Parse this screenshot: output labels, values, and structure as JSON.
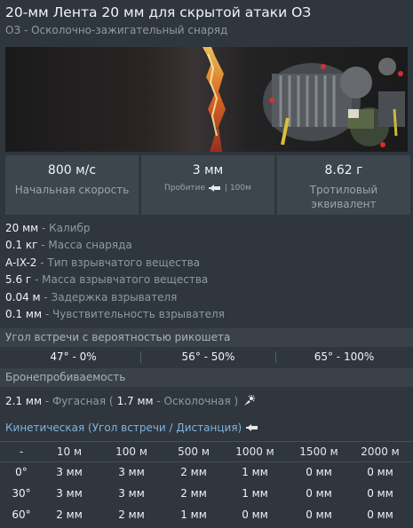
{
  "header": {
    "title": "20-мм Лента 20 мм для скрытой атаки ОЗ",
    "subtitle": "ОЗ - Осколочно-зажигательный снаряд"
  },
  "stats": {
    "velocity": {
      "value": "800 м/с",
      "label": "Начальная скорость"
    },
    "penetration": {
      "value": "3 мм",
      "label": "Пробитие",
      "distance": "| 100м"
    },
    "tnt": {
      "value": "8.62 г",
      "label": "Тротиловый эквивалент"
    }
  },
  "characteristics": [
    {
      "value": "20 мм",
      "label": " - Калибр"
    },
    {
      "value": "0.1 кг",
      "label": " - Масса снаряда"
    },
    {
      "value": "A-IX-2",
      "label": " - Тип взрывчатого вещества"
    },
    {
      "value": "5.6 г",
      "label": " - Масса взрывчатого вещества"
    },
    {
      "value": "0.04 м",
      "label": " - Задержка взрывателя"
    },
    {
      "value": "0.1 мм",
      "label": " - Чувствительность взрывателя"
    }
  ],
  "ricochet": {
    "title": "Угол встречи с вероятностью рикошета",
    "values": [
      "47° - 0%",
      "56° - 50%",
      "65° - 100%"
    ]
  },
  "armor": {
    "title": "Бронепробиваемость",
    "he_value": "2.1 мм",
    "he_label": " - Фугасная (",
    "frag_value": "1.7 мм",
    "frag_label": " - Осколочная )",
    "kinetic_title": "Кинетическая (Угол встречи / Дистанция)"
  },
  "table": {
    "headers": [
      "-",
      "10 м",
      "100 м",
      "500 м",
      "1000 м",
      "1500 м",
      "2000 м"
    ],
    "rows": [
      [
        "0°",
        "3 мм",
        "3 мм",
        "2 мм",
        "1 мм",
        "0 мм",
        "0 мм"
      ],
      [
        "30°",
        "3 мм",
        "3 мм",
        "2 мм",
        "1 мм",
        "0 мм",
        "0 мм"
      ],
      [
        "60°",
        "2 мм",
        "2 мм",
        "1 мм",
        "0 мм",
        "0 мм",
        "0 мм"
      ]
    ]
  },
  "icons": {
    "penetration_shell": "shell-icon",
    "fragmentation": "frag-icon",
    "kinetic_shell": "shell-icon"
  },
  "colors": {
    "background": "#2f363d",
    "card": "#3d454d",
    "accent": "#7fb4dc",
    "muted": "#8f9aa5"
  }
}
